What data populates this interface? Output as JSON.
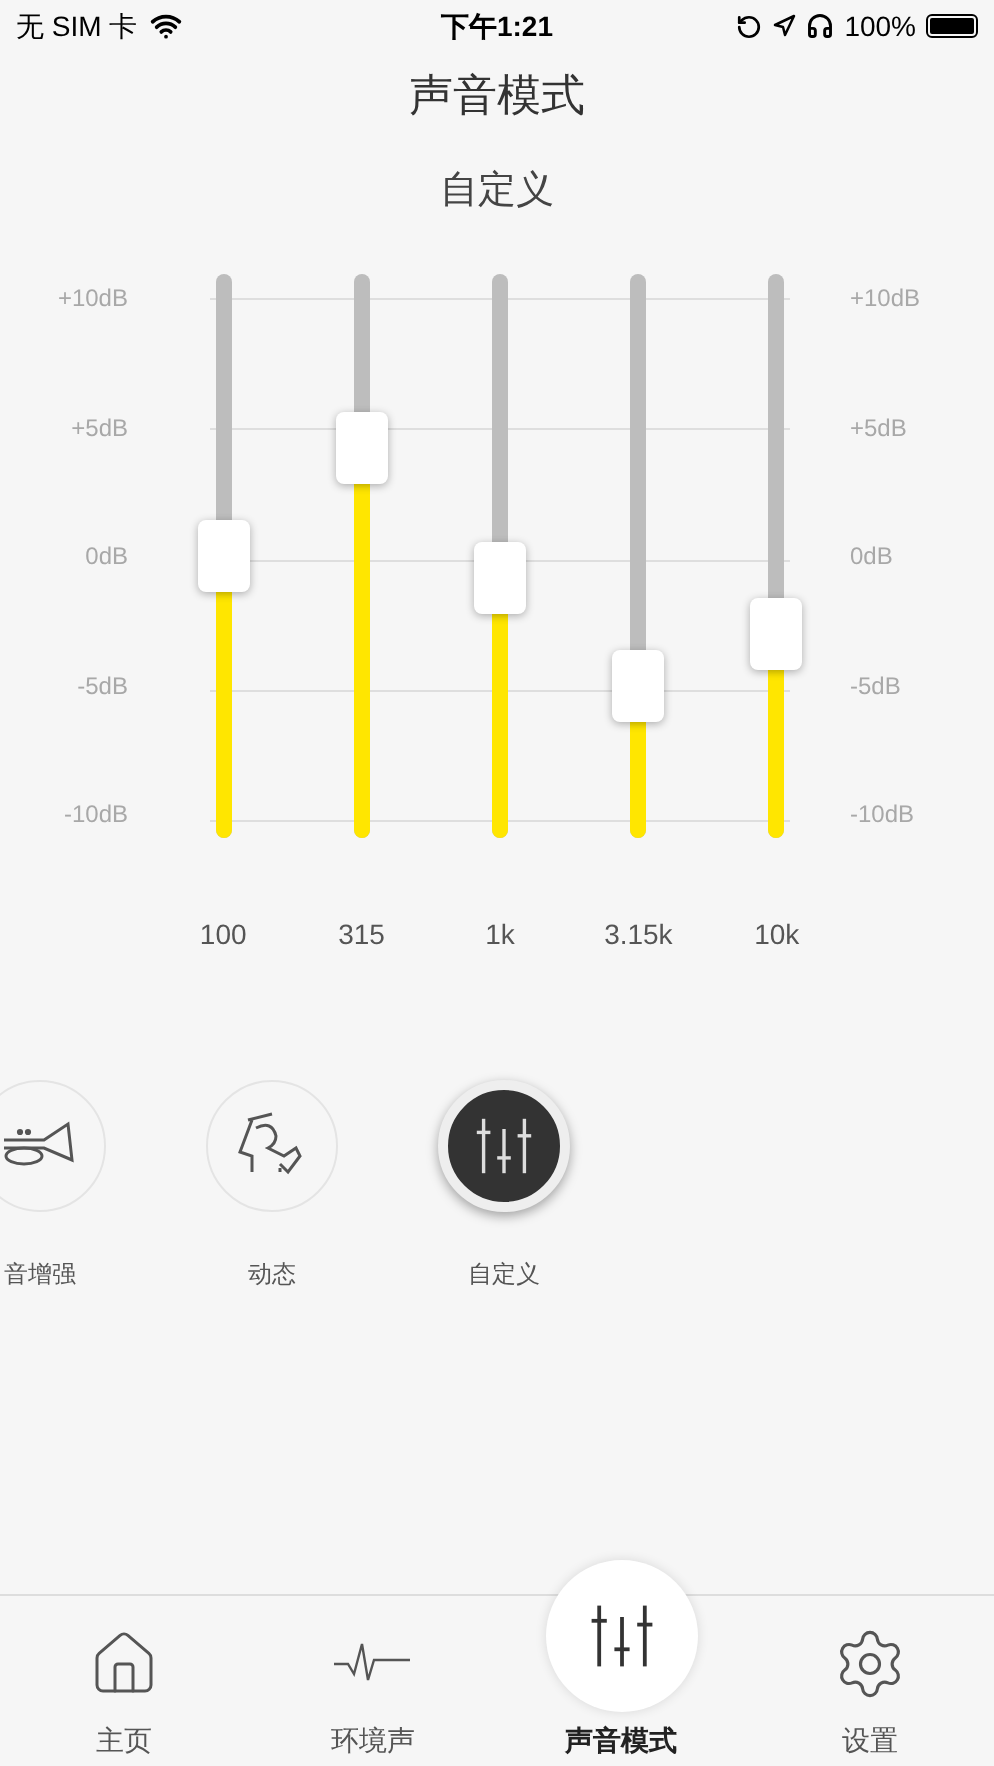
{
  "status_bar": {
    "carrier": "无 SIM 卡",
    "time": "下午1:21",
    "battery": "100%"
  },
  "title": "声音模式",
  "preset_name": "自定义",
  "scale_left": [
    "+10dB",
    "+5dB",
    "0dB",
    "-5dB",
    "-10dB"
  ],
  "scale_right": [
    "+10dB",
    "+5dB",
    "0dB",
    "-5dB",
    "-10dB"
  ],
  "bands": [
    {
      "label": "100",
      "level": 0.5
    },
    {
      "label": "315",
      "level": 0.69
    },
    {
      "label": "1k",
      "level": 0.46
    },
    {
      "label": "3.15k",
      "level": 0.27
    },
    {
      "label": "10k",
      "level": 0.36
    }
  ],
  "modes": [
    {
      "kind": "trumpet",
      "label": "音增强",
      "selected": false
    },
    {
      "kind": "dancer",
      "label": "动态",
      "selected": false
    },
    {
      "kind": "sliders",
      "label": "自定义",
      "selected": true
    }
  ],
  "tabs": [
    {
      "kind": "home",
      "label": "主页",
      "selected": false
    },
    {
      "kind": "pulse",
      "label": "环境声",
      "selected": false
    },
    {
      "kind": "sliders",
      "label": "声音模式",
      "selected": true
    },
    {
      "kind": "settings",
      "label": "设置",
      "selected": false
    }
  ]
}
